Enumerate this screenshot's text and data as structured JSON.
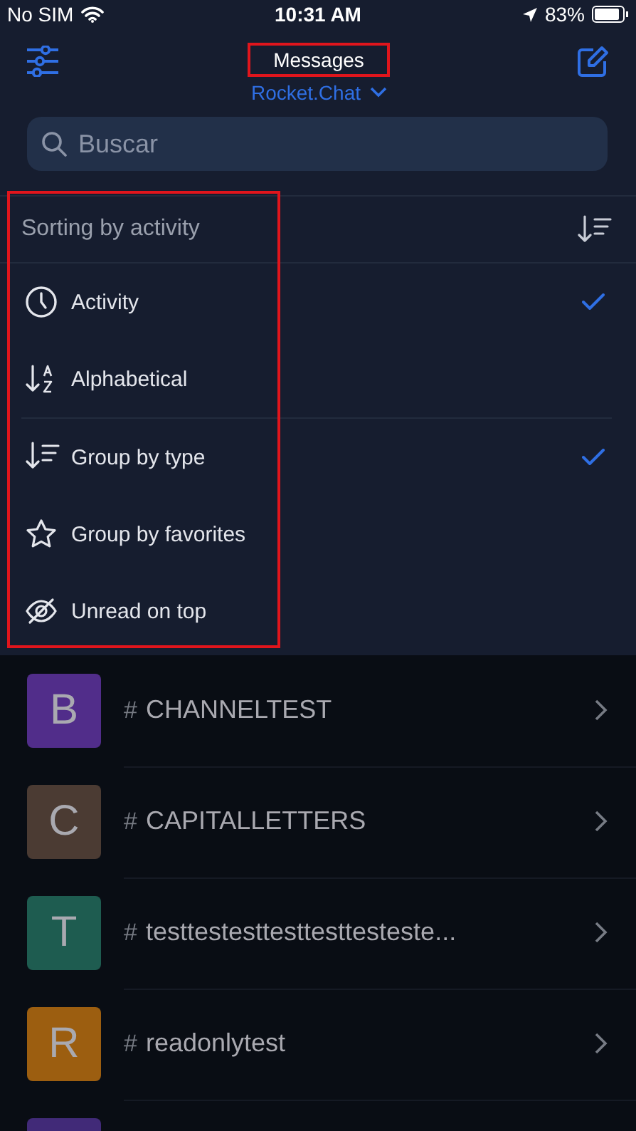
{
  "status_bar": {
    "carrier": "No SIM",
    "time": "10:31 AM",
    "battery": "83%"
  },
  "header": {
    "title": "Messages",
    "title_highlighted": true,
    "server": "Rocket.Chat"
  },
  "search": {
    "placeholder": "Buscar"
  },
  "sort_menu": {
    "title": "Sorting by activity",
    "highlighted": true,
    "sort_options": [
      {
        "label": "Activity",
        "checked": true
      },
      {
        "label": "Alphabetical",
        "checked": false
      }
    ],
    "group_options": [
      {
        "label": "Group by type",
        "checked": true
      },
      {
        "label": "Group by favorites",
        "checked": false
      },
      {
        "label": "Unread on top",
        "checked": false
      }
    ]
  },
  "rooms": [
    {
      "letter": "B",
      "color": "#512d8a",
      "prefix": "#",
      "name": "CHANNELTEST"
    },
    {
      "letter": "C",
      "color": "#4b3b33",
      "prefix": "#",
      "name": "CAPITALLETTERS"
    },
    {
      "letter": "T",
      "color": "#1e5c50",
      "prefix": "#",
      "name": "testtestesttesttesttesteste..."
    },
    {
      "letter": "R",
      "color": "#9c5e10",
      "prefix": "#",
      "name": "readonlytest"
    },
    {
      "color": "#412a78"
    }
  ]
}
